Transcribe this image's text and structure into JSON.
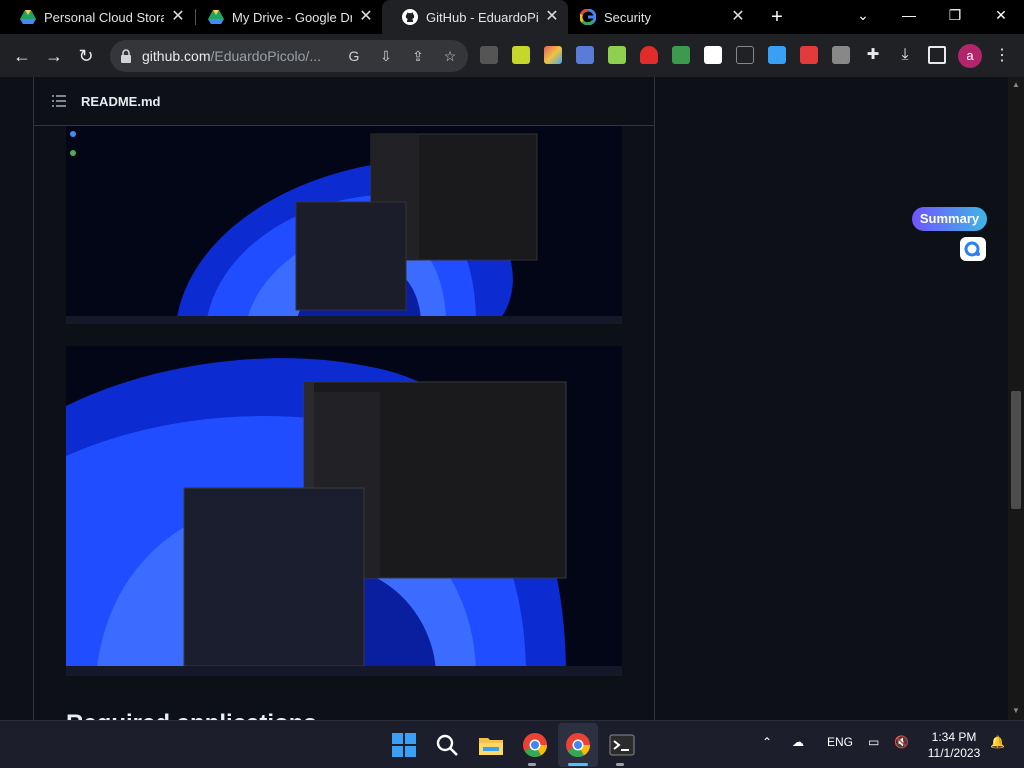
{
  "browser": {
    "tabs": [
      {
        "title": "Personal Cloud Storag",
        "favicon": "google-drive-icon",
        "active": false
      },
      {
        "title": "My Drive - Google Dri",
        "favicon": "google-drive-icon",
        "active": false
      },
      {
        "title": "GitHub - EduardoPicol",
        "favicon": "github-icon",
        "active": true
      },
      {
        "title": "Security",
        "favicon": "google-icon",
        "active": false
      }
    ],
    "close_glyph": "✕",
    "new_tab_glyph": "+",
    "url_host": "github.com",
    "url_path": "/EduardoPicolo/...",
    "avatar_letter": "a"
  },
  "readme": {
    "file_name": "README.md",
    "next_heading": "Required applications"
  },
  "extension_overlay": {
    "summary_label": "Summary"
  },
  "taskbar": {
    "language": "ENG",
    "time": "1:34 PM",
    "date": "11/1/2023"
  },
  "colors": {
    "accent_wallpaper": "#1a4bff",
    "github_bg": "#0d1117",
    "taskbar_bg": "#1c1f2b"
  }
}
